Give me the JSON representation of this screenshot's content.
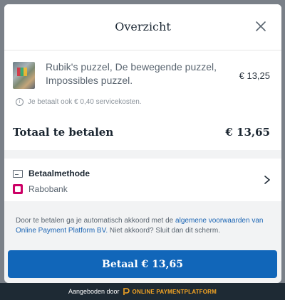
{
  "header": {
    "title": "Overzicht"
  },
  "order": {
    "product_name": "Rubik's puzzel, De bewegende puzzel, Impossibles puzzel.",
    "product_price": "€ 13,25",
    "service_note": "Je betaalt ook € 0,40 servicekosten.",
    "total_label": "Totaal te betalen",
    "total_amount": "€ 13,65"
  },
  "payment": {
    "method_label": "Betaalmethode",
    "bank": "Rabobank"
  },
  "terms": {
    "prefix": "Door te betalen ga je automatisch akkoord met de ",
    "link": "algemene voorwaarden van Online Payment Platform BV.",
    "suffix": "  Niet akkoord? Sluit dan dit scherm."
  },
  "pay_button": {
    "label": "Betaal  € 13,65"
  },
  "footer": {
    "offered_by": "Aangeboden door",
    "brand": "ONLINE PAYMENTPLATFORM"
  },
  "colors": {
    "primary": "#1166b9",
    "footer_bg": "#1e2a34",
    "brand_accent": "#f5a524",
    "ideal": "#cc0066"
  },
  "icons": [
    "close-icon",
    "info-icon",
    "card-icon",
    "ideal-icon",
    "chevron-right-icon",
    "opp-logo-icon"
  ]
}
